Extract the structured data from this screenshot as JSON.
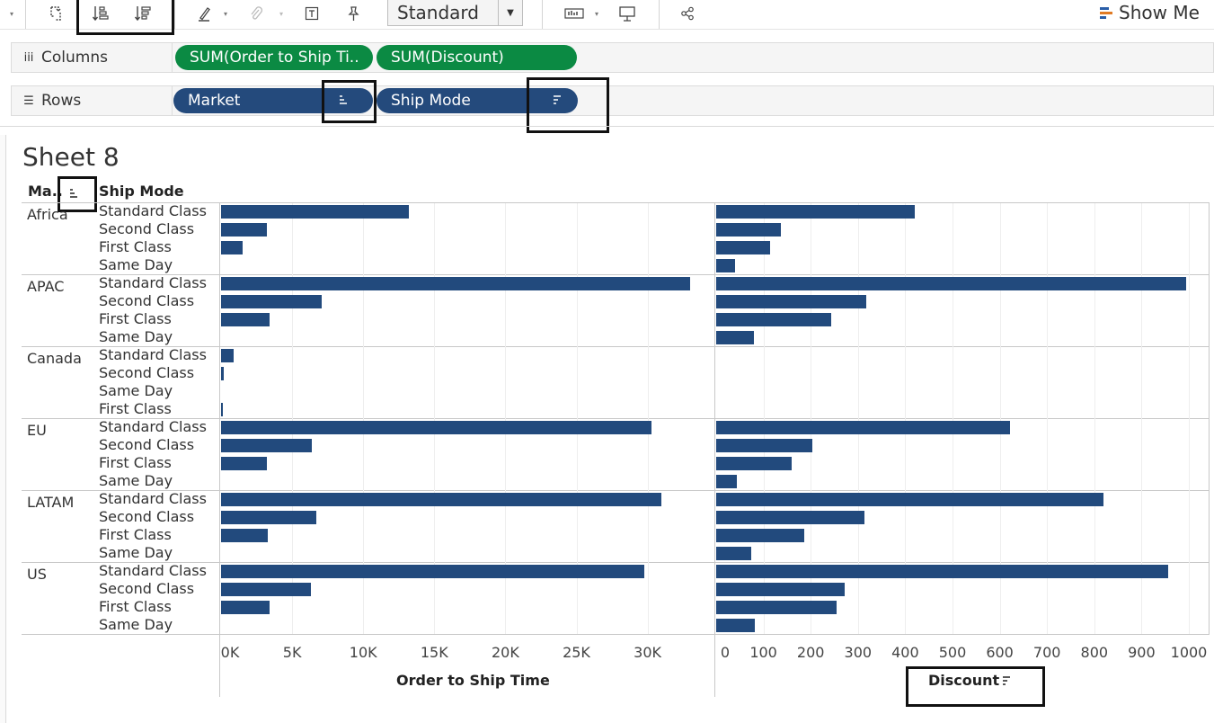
{
  "toolbar": {
    "mark_type": "Standard",
    "show_me": "Show Me"
  },
  "shelves": {
    "columns_label": "Columns",
    "rows_label": "Rows",
    "columns": [
      "SUM(Order to Ship Ti..",
      "SUM(Discount)"
    ],
    "rows": [
      "Market",
      "Ship Mode"
    ]
  },
  "sheet": {
    "title": "Sheet 8",
    "header_market": "Ma..",
    "header_ship_mode": "Ship Mode"
  },
  "colors": {
    "bar": "#224a7d",
    "measure_pill": "#0b8a43",
    "dimension_pill": "#244a7c"
  },
  "chart_data": [
    {
      "type": "bar",
      "orientation": "horizontal",
      "xlabel": "Order to Ship Time",
      "xlim": [
        0,
        35000
      ],
      "tick_labels": [
        "0K",
        "5K",
        "10K",
        "15K",
        "20K",
        "25K",
        "30K"
      ],
      "ticks": [
        0,
        5000,
        10000,
        15000,
        20000,
        25000,
        30000
      ],
      "groups": [
        {
          "market": "Africa",
          "rows": [
            {
              "ship_mode": "Standard Class",
              "value": 13200
            },
            {
              "ship_mode": "Second Class",
              "value": 3200
            },
            {
              "ship_mode": "First Class",
              "value": 1500
            },
            {
              "ship_mode": "Same Day",
              "value": 0
            }
          ]
        },
        {
          "market": "APAC",
          "rows": [
            {
              "ship_mode": "Standard Class",
              "value": 33000
            },
            {
              "ship_mode": "Second Class",
              "value": 7100
            },
            {
              "ship_mode": "First Class",
              "value": 3400
            },
            {
              "ship_mode": "Same Day",
              "value": 0
            }
          ]
        },
        {
          "market": "Canada",
          "rows": [
            {
              "ship_mode": "Standard Class",
              "value": 900
            },
            {
              "ship_mode": "Second Class",
              "value": 200
            },
            {
              "ship_mode": "Same Day",
              "value": 0
            },
            {
              "ship_mode": "First Class",
              "value": 100
            }
          ]
        },
        {
          "market": "EU",
          "rows": [
            {
              "ship_mode": "Standard Class",
              "value": 30300
            },
            {
              "ship_mode": "Second Class",
              "value": 6400
            },
            {
              "ship_mode": "First Class",
              "value": 3200
            },
            {
              "ship_mode": "Same Day",
              "value": 0
            }
          ]
        },
        {
          "market": "LATAM",
          "rows": [
            {
              "ship_mode": "Standard Class",
              "value": 31000
            },
            {
              "ship_mode": "Second Class",
              "value": 6700
            },
            {
              "ship_mode": "First Class",
              "value": 3300
            },
            {
              "ship_mode": "Same Day",
              "value": 0
            }
          ]
        },
        {
          "market": "US",
          "rows": [
            {
              "ship_mode": "Standard Class",
              "value": 29800
            },
            {
              "ship_mode": "Second Class",
              "value": 6300
            },
            {
              "ship_mode": "First Class",
              "value": 3400
            },
            {
              "ship_mode": "Same Day",
              "value": 0
            }
          ]
        }
      ]
    },
    {
      "type": "bar",
      "orientation": "horizontal",
      "xlabel": "Discount",
      "xlim": [
        0,
        1000
      ],
      "tick_labels": [
        "0",
        "100",
        "200",
        "300",
        "400",
        "500",
        "600",
        "700",
        "800",
        "900",
        "1000"
      ],
      "ticks": [
        0,
        100,
        200,
        300,
        400,
        500,
        600,
        700,
        800,
        900,
        1000
      ],
      "groups": [
        {
          "market": "Africa",
          "rows": [
            {
              "ship_mode": "Standard Class",
              "value": 420
            },
            {
              "ship_mode": "Second Class",
              "value": 137
            },
            {
              "ship_mode": "First Class",
              "value": 114
            },
            {
              "ship_mode": "Same Day",
              "value": 40
            }
          ]
        },
        {
          "market": "APAC",
          "rows": [
            {
              "ship_mode": "Standard Class",
              "value": 995
            },
            {
              "ship_mode": "Second Class",
              "value": 317
            },
            {
              "ship_mode": "First Class",
              "value": 244
            },
            {
              "ship_mode": "Same Day",
              "value": 80
            }
          ]
        },
        {
          "market": "Canada",
          "rows": [
            {
              "ship_mode": "Standard Class",
              "value": 0
            },
            {
              "ship_mode": "Second Class",
              "value": 0
            },
            {
              "ship_mode": "Same Day",
              "value": 0
            },
            {
              "ship_mode": "First Class",
              "value": 0
            }
          ]
        },
        {
          "market": "EU",
          "rows": [
            {
              "ship_mode": "Standard Class",
              "value": 621
            },
            {
              "ship_mode": "Second Class",
              "value": 204
            },
            {
              "ship_mode": "First Class",
              "value": 159
            },
            {
              "ship_mode": "Same Day",
              "value": 44
            }
          ]
        },
        {
          "market": "LATAM",
          "rows": [
            {
              "ship_mode": "Standard Class",
              "value": 819
            },
            {
              "ship_mode": "Second Class",
              "value": 314
            },
            {
              "ship_mode": "First Class",
              "value": 187
            },
            {
              "ship_mode": "Same Day",
              "value": 74
            }
          ]
        },
        {
          "market": "US",
          "rows": [
            {
              "ship_mode": "Standard Class",
              "value": 956
            },
            {
              "ship_mode": "Second Class",
              "value": 271
            },
            {
              "ship_mode": "First Class",
              "value": 254
            },
            {
              "ship_mode": "Same Day",
              "value": 82
            }
          ]
        }
      ]
    }
  ]
}
